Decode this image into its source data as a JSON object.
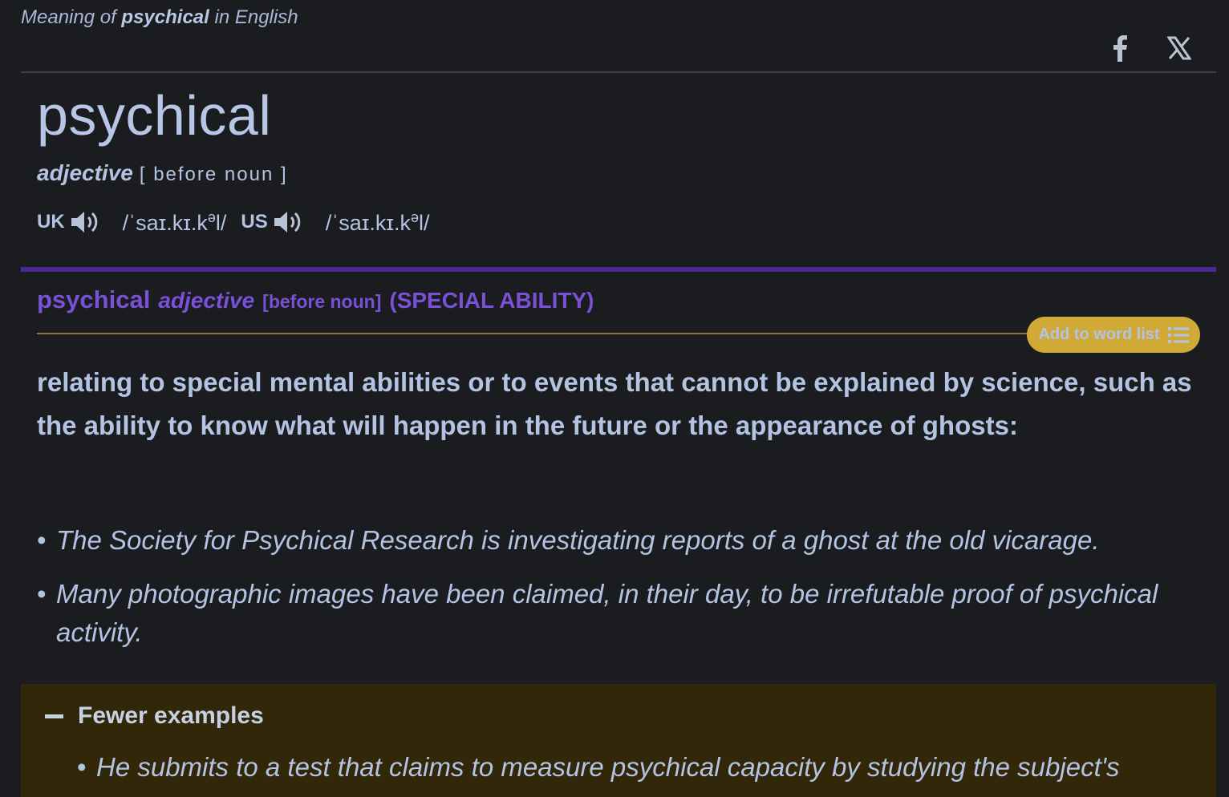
{
  "header": {
    "meaning_prefix": "Meaning of",
    "meaning_word": "psychical",
    "meaning_suffix": "in English"
  },
  "share": {
    "facebook_icon": "facebook-icon",
    "x_icon": "x-twitter-icon"
  },
  "entry": {
    "headword": "psychical",
    "pos": "adjective",
    "grammar": "[ before noun ]",
    "pronunciations": [
      {
        "region": "UK",
        "ipa": "/ˈsaɪ.kɪ.k",
        "ipa_sup": "ə",
        "ipa_end": "l/"
      },
      {
        "region": "US",
        "ipa": "/ˈsaɪ.kɪ.k",
        "ipa_sup": "ə",
        "ipa_end": "l/"
      }
    ]
  },
  "sense": {
    "headword": "psychical",
    "pos": "adjective",
    "grammar": "[before noun]",
    "guideword": "(SPECIAL ABILITY)",
    "add_to_word_list": "Add to word list",
    "definition": "relating to special mental abilities or to events that cannot be explained by science, such as the ability to know what will happen in the future or the appearance of ghosts:",
    "examples": [
      "The Society for Psychical Research is investigating reports of a ghost at the old vicarage.",
      "Many photographic images have been claimed, in their day, to be irrefutable proof of psychical activity."
    ]
  },
  "more_examples": {
    "toggle_label": "Fewer examples",
    "items": [
      "He submits to a test that claims to measure psychical capacity by studying the subject's"
    ]
  },
  "colors": {
    "background": "#1b1c20",
    "text": "#b3c3e2",
    "sense_purple": "#7a51d6",
    "rule_purple": "#4b2795",
    "gold_button": "#d0a936",
    "examples_panel": "#33270a"
  }
}
